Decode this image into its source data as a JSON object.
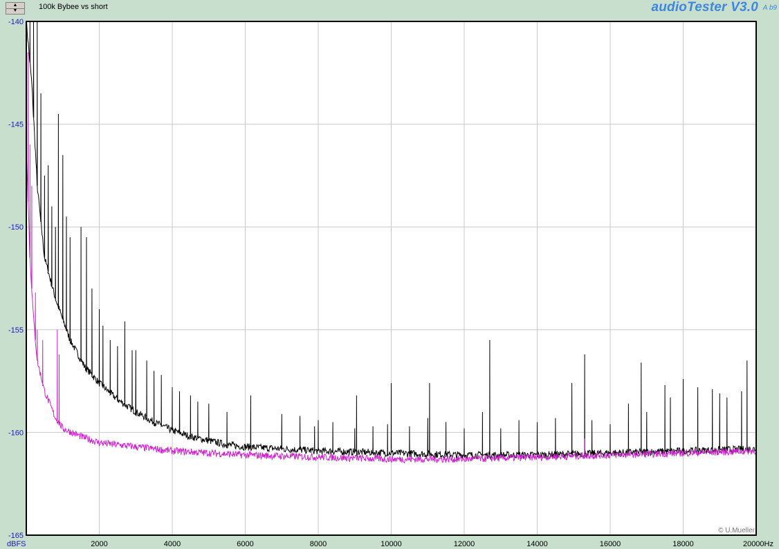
{
  "header": {
    "title_value": "100k Bybee vs short",
    "brand": "audioTester V3.0",
    "brand_version": "A b9",
    "spinner_up": "▲",
    "spinner_down": "▼"
  },
  "footer": {
    "credit": "© U.Mueller"
  },
  "colors": {
    "background": "#c7dfcc",
    "plot": "#ffffff",
    "grid": "#c8c8c8",
    "brand": "#3f86e0",
    "ytick": "#1a1ab8"
  },
  "chart_data": {
    "type": "line",
    "xlim": [
      0,
      20000
    ],
    "ylim": [
      -165,
      -140
    ],
    "x_ticks": [
      2000,
      4000,
      6000,
      8000,
      10000,
      12000,
      14000,
      16000,
      18000
    ],
    "x_tick_labels": [
      "2000",
      "4000",
      "6000",
      "8000",
      "10000",
      "12000",
      "14000",
      "16000",
      "18000"
    ],
    "x_end_label": "20000Hz",
    "y_ticks": [
      -140,
      -145,
      -150,
      -155,
      -160,
      -165
    ],
    "y_tick_labels": [
      "-140",
      "-145",
      "-150",
      "-155",
      "-160",
      "-165"
    ],
    "y_unit_label": "dBFS",
    "grid": true,
    "series": [
      {
        "color": "#000000",
        "floor": [
          [
            0,
            -140
          ],
          [
            150,
            -143
          ],
          [
            300,
            -148
          ],
          [
            500,
            -151.5
          ],
          [
            800,
            -153.5
          ],
          [
            1200,
            -155.5
          ],
          [
            1600,
            -156.8
          ],
          [
            2000,
            -157.6
          ],
          [
            2500,
            -158.4
          ],
          [
            3000,
            -159
          ],
          [
            3500,
            -159.5
          ],
          [
            4000,
            -159.9
          ],
          [
            4500,
            -160.2
          ],
          [
            5000,
            -160.4
          ],
          [
            5500,
            -160.6
          ],
          [
            6000,
            -160.7
          ],
          [
            7000,
            -160.8
          ],
          [
            8000,
            -160.9
          ],
          [
            10000,
            -161
          ],
          [
            12000,
            -161.1
          ],
          [
            14000,
            -161.1
          ],
          [
            16000,
            -161
          ],
          [
            18000,
            -160.9
          ],
          [
            20000,
            -160.8
          ]
        ],
        "peaks": [
          [
            100,
            -140
          ],
          [
            200,
            -140
          ],
          [
            300,
            -140
          ],
          [
            400,
            -143.5
          ],
          [
            500,
            -147.5
          ],
          [
            600,
            -147
          ],
          [
            700,
            -149
          ],
          [
            800,
            -150
          ],
          [
            880,
            -144.5
          ],
          [
            1000,
            -146.5
          ],
          [
            1100,
            -149.5
          ],
          [
            1200,
            -150.5
          ],
          [
            1500,
            -150
          ],
          [
            1650,
            -150.5
          ],
          [
            1800,
            -153
          ],
          [
            2000,
            -154
          ],
          [
            2100,
            -154.8
          ],
          [
            2300,
            -155.5
          ],
          [
            2500,
            -155.8
          ],
          [
            2700,
            -154.6
          ],
          [
            2900,
            -156
          ],
          [
            3000,
            -156
          ],
          [
            3300,
            -156.5
          ],
          [
            3500,
            -157
          ],
          [
            3700,
            -157.2
          ],
          [
            4000,
            -157.8
          ],
          [
            4200,
            -158
          ],
          [
            4500,
            -158.2
          ],
          [
            4700,
            -158.5
          ],
          [
            5000,
            -158.6
          ],
          [
            5500,
            -159
          ],
          [
            6150,
            -158.2
          ],
          [
            7000,
            -159.1
          ],
          [
            7500,
            -159.2
          ],
          [
            7900,
            -159.7
          ],
          [
            8000,
            -159.4
          ],
          [
            8400,
            -159.5
          ],
          [
            9000,
            -159.8
          ],
          [
            9050,
            -158.2
          ],
          [
            9500,
            -159.7
          ],
          [
            9900,
            -159.6
          ],
          [
            10000,
            -157.6
          ],
          [
            10500,
            -159.7
          ],
          [
            11000,
            -159.3
          ],
          [
            11050,
            -157.6
          ],
          [
            11500,
            -159.5
          ],
          [
            12000,
            -159.8
          ],
          [
            12500,
            -159
          ],
          [
            12700,
            -155.5
          ],
          [
            13000,
            -159.8
          ],
          [
            13500,
            -159.4
          ],
          [
            14000,
            -159.5
          ],
          [
            14500,
            -159.3
          ],
          [
            14950,
            -157.6
          ],
          [
            15300,
            -156.2
          ],
          [
            15500,
            -159.4
          ],
          [
            16000,
            -159.6
          ],
          [
            16500,
            -158.6
          ],
          [
            16850,
            -156.6
          ],
          [
            17000,
            -159
          ],
          [
            17500,
            -157.7
          ],
          [
            17650,
            -158.3
          ],
          [
            18000,
            -157.4
          ],
          [
            18400,
            -157.8
          ],
          [
            18800,
            -157.9
          ],
          [
            19000,
            -158.1
          ],
          [
            19200,
            -158.3
          ],
          [
            19600,
            -158
          ],
          [
            19750,
            -156.5
          ],
          [
            20000,
            -160.3
          ]
        ]
      },
      {
        "color": "#cc22cc",
        "floor": [
          [
            0,
            -146
          ],
          [
            100,
            -151.5
          ],
          [
            200,
            -154.5
          ],
          [
            300,
            -156.5
          ],
          [
            500,
            -158
          ],
          [
            800,
            -159.3
          ],
          [
            1000,
            -159.8
          ],
          [
            1500,
            -160.2
          ],
          [
            2000,
            -160.5
          ],
          [
            3000,
            -160.7
          ],
          [
            4000,
            -160.9
          ],
          [
            5000,
            -161
          ],
          [
            6000,
            -161.1
          ],
          [
            8000,
            -161.2
          ],
          [
            10000,
            -161.3
          ],
          [
            12000,
            -161.3
          ],
          [
            14000,
            -161.2
          ],
          [
            16000,
            -161.1
          ],
          [
            18000,
            -161
          ],
          [
            20000,
            -160.9
          ]
        ],
        "peaks": [
          [
            50,
            -141.5
          ],
          [
            100,
            -146
          ],
          [
            150,
            -148
          ],
          [
            250,
            -153.2
          ],
          [
            300,
            -155
          ],
          [
            450,
            -155.5
          ],
          [
            850,
            -155
          ],
          [
            900,
            -156.2
          ],
          [
            15300,
            -160.3
          ]
        ]
      }
    ]
  }
}
